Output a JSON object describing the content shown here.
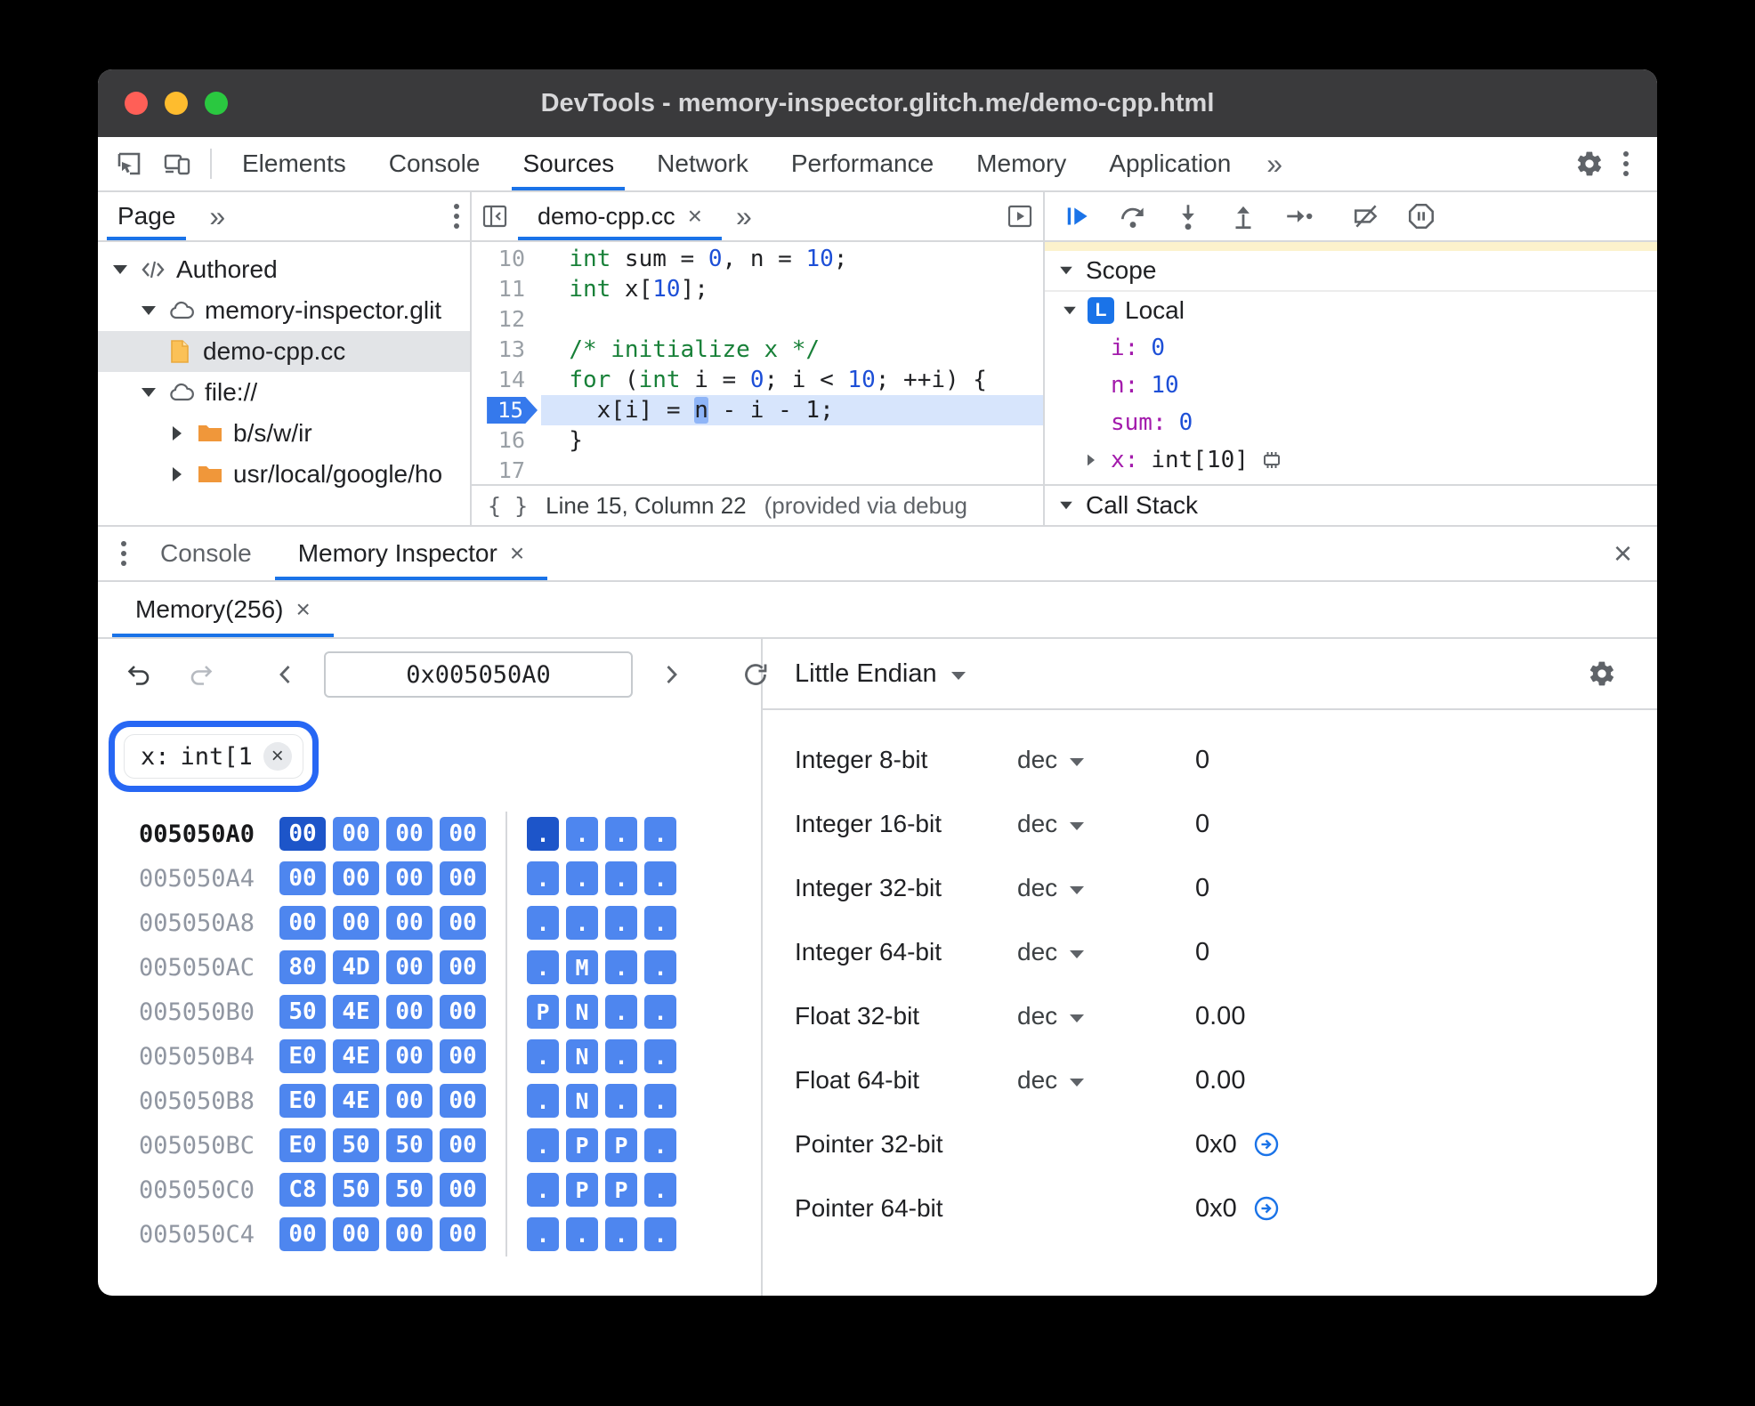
{
  "window": {
    "title": "DevTools - memory-inspector.glitch.me/demo-cpp.html"
  },
  "glyphs": {
    "close": "×",
    "more": "»",
    "pretty_print": "{ }"
  },
  "toolbar": {
    "left_icons": [
      "inspect-icon",
      "device-toolbar-icon"
    ],
    "tabs": [
      {
        "label": "Elements",
        "active": false
      },
      {
        "label": "Console",
        "active": false
      },
      {
        "label": "Sources",
        "active": true
      },
      {
        "label": "Network",
        "active": false
      },
      {
        "label": "Performance",
        "active": false
      },
      {
        "label": "Memory",
        "active": false
      },
      {
        "label": "Application",
        "active": false
      }
    ],
    "right_icons": [
      "settings-icon",
      "more-menu-icon"
    ]
  },
  "navigator": {
    "tab_label": "Page",
    "tree": [
      {
        "label": "Authored",
        "icon": "code",
        "depth": 0,
        "expander": "down"
      },
      {
        "label": "memory-inspector.glit",
        "icon": "cloud",
        "depth": 1,
        "expander": "down"
      },
      {
        "label": "demo-cpp.cc",
        "icon": "file",
        "depth": 2,
        "expander": "none",
        "selected": true
      },
      {
        "label": "file://",
        "icon": "cloud",
        "depth": 1,
        "expander": "down"
      },
      {
        "label": "b/s/w/ir",
        "icon": "folder",
        "depth": 2,
        "expander": "right"
      },
      {
        "label": "usr/local/google/ho",
        "icon": "folder",
        "depth": 2,
        "expander": "right"
      }
    ]
  },
  "editor": {
    "tab_label": "demo-cpp.cc",
    "lines": [
      {
        "no": "10",
        "segments": [
          {
            "t": "pl",
            "s": "  "
          },
          {
            "t": "kw",
            "s": "int"
          },
          {
            "t": "pl",
            "s": " sum = "
          },
          {
            "t": "num",
            "s": "0"
          },
          {
            "t": "pl",
            "s": ", n = "
          },
          {
            "t": "num",
            "s": "10"
          },
          {
            "t": "pl",
            "s": ";"
          }
        ]
      },
      {
        "no": "11",
        "segments": [
          {
            "t": "pl",
            "s": "  "
          },
          {
            "t": "kw",
            "s": "int"
          },
          {
            "t": "pl",
            "s": " x["
          },
          {
            "t": "num",
            "s": "10"
          },
          {
            "t": "pl",
            "s": "];"
          }
        ]
      },
      {
        "no": "12",
        "segments": []
      },
      {
        "no": "13",
        "segments": [
          {
            "t": "pl",
            "s": "  "
          },
          {
            "t": "com",
            "s": "/* initialize x */"
          }
        ]
      },
      {
        "no": "14",
        "segments": [
          {
            "t": "pl",
            "s": "  "
          },
          {
            "t": "kw",
            "s": "for"
          },
          {
            "t": "pl",
            "s": " ("
          },
          {
            "t": "kw",
            "s": "int"
          },
          {
            "t": "pl",
            "s": " i = "
          },
          {
            "t": "num",
            "s": "0"
          },
          {
            "t": "pl",
            "s": "; i < "
          },
          {
            "t": "num",
            "s": "10"
          },
          {
            "t": "pl",
            "s": "; ++i) {"
          }
        ]
      },
      {
        "no": "15",
        "current": true,
        "segments": [
          {
            "t": "pl",
            "s": "    x[i] = "
          },
          {
            "t": "hl",
            "s": "n"
          },
          {
            "t": "pl",
            "s": " - i - 1;"
          }
        ]
      },
      {
        "no": "16",
        "segments": [
          {
            "t": "pl",
            "s": "  }"
          }
        ]
      },
      {
        "no": "17",
        "segments": []
      }
    ],
    "status_position": "Line 15, Column 22",
    "status_note": "(provided via debug"
  },
  "debugger": {
    "toolbar_icons": [
      "resume-icon",
      "step-over-icon",
      "step-into-icon",
      "step-out-icon",
      "step-icon",
      "deactivate-breakpoints-icon",
      "pause-on-exceptions-icon"
    ],
    "scope_title": "Scope",
    "local_badge": "L",
    "local_label": "Local",
    "variables": [
      {
        "name": "i",
        "value": "0"
      },
      {
        "name": "n",
        "value": "10"
      },
      {
        "name": "sum",
        "value": "0"
      },
      {
        "name": "x",
        "type": "int[10]",
        "expander": "right",
        "memory_icon": true
      }
    ],
    "callstack_title": "Call Stack"
  },
  "drawer": {
    "console_tab": "Console",
    "memory_tab": "Memory Inspector"
  },
  "memory": {
    "panel_tab": "Memory(256)",
    "toolbar_icons": [
      "undo-icon",
      "redo-icon",
      "chevron-left-icon",
      "chevron-right-icon",
      "refresh-icon"
    ],
    "address_value": "0x005050A0",
    "tag_name": "x:",
    "tag_type": "int[1",
    "rows": [
      {
        "address": "005050A0",
        "bytes": [
          "00",
          "00",
          "00",
          "00"
        ],
        "ascii": [
          ".",
          ".",
          ".",
          "."
        ],
        "selected": 0
      },
      {
        "address": "005050A4",
        "bytes": [
          "00",
          "00",
          "00",
          "00"
        ],
        "ascii": [
          ".",
          ".",
          ".",
          "."
        ]
      },
      {
        "address": "005050A8",
        "bytes": [
          "00",
          "00",
          "00",
          "00"
        ],
        "ascii": [
          ".",
          ".",
          ".",
          "."
        ]
      },
      {
        "address": "005050AC",
        "bytes": [
          "80",
          "4D",
          "00",
          "00"
        ],
        "ascii": [
          ".",
          "M",
          ".",
          "."
        ]
      },
      {
        "address": "005050B0",
        "bytes": [
          "50",
          "4E",
          "00",
          "00"
        ],
        "ascii": [
          "P",
          "N",
          ".",
          "."
        ]
      },
      {
        "address": "005050B4",
        "bytes": [
          "E0",
          "4E",
          "00",
          "00"
        ],
        "ascii": [
          ".",
          "N",
          ".",
          "."
        ]
      },
      {
        "address": "005050B8",
        "bytes": [
          "E0",
          "4E",
          "00",
          "00"
        ],
        "ascii": [
          ".",
          "N",
          ".",
          "."
        ]
      },
      {
        "address": "005050BC",
        "bytes": [
          "E0",
          "50",
          "50",
          "00"
        ],
        "ascii": [
          ".",
          "P",
          "P",
          "."
        ]
      },
      {
        "address": "005050C0",
        "bytes": [
          "C8",
          "50",
          "50",
          "00"
        ],
        "ascii": [
          ".",
          "P",
          "P",
          "."
        ]
      },
      {
        "address": "005050C4",
        "bytes": [
          "00",
          "00",
          "00",
          "00"
        ],
        "ascii": [
          ".",
          ".",
          ".",
          "."
        ]
      }
    ]
  },
  "interpreter": {
    "endianness": "Little Endian",
    "rows": [
      {
        "label": "Integer 8-bit",
        "format": "dec",
        "value": "0"
      },
      {
        "label": "Integer 16-bit",
        "format": "dec",
        "value": "0"
      },
      {
        "label": "Integer 32-bit",
        "format": "dec",
        "value": "0"
      },
      {
        "label": "Integer 64-bit",
        "format": "dec",
        "value": "0"
      },
      {
        "label": "Float 32-bit",
        "format": "dec",
        "value": "0.00"
      },
      {
        "label": "Float 64-bit",
        "format": "dec",
        "value": "0.00"
      },
      {
        "label": "Pointer 32-bit",
        "value": "0x0",
        "jump": true
      },
      {
        "label": "Pointer 64-bit",
        "value": "0x0",
        "jump": true
      }
    ]
  },
  "colors": {
    "accent": "#1a73e8",
    "byte_cell": "#4e86ef",
    "byte_cell_selected": "#1d55c9",
    "keyword": "#188038",
    "comment": "#188038",
    "number": "#1d4fd7",
    "variable_name": "#a31bac",
    "execution_line": "#d7e5fc"
  }
}
